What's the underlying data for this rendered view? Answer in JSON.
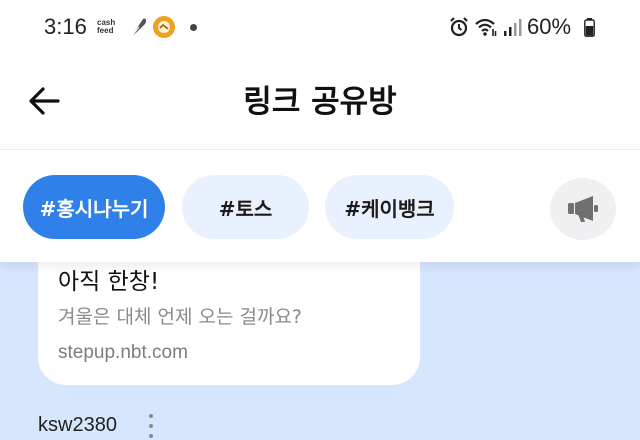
{
  "status_bar": {
    "time": "3:16",
    "cashfeed_text": "cash feed",
    "battery": "60%",
    "icons": [
      "feather-icon",
      "app-notification-icon",
      "notification-dot-icon",
      "alarm-icon",
      "wifi-icon",
      "signal-icon",
      "battery-icon"
    ]
  },
  "header": {
    "title": "링크 공유방",
    "back_icon": "arrow-left-icon"
  },
  "tags": {
    "items": [
      {
        "label": "#홍시나누기",
        "active": true
      },
      {
        "label": "#토스",
        "active": false
      },
      {
        "label": "#케이뱅크",
        "active": false
      }
    ],
    "action_icon": "megaphone-icon"
  },
  "post": {
    "card": {
      "title": "아직 한창!",
      "description": "겨울은 대체 언제 오는 걸까요?",
      "url": "stepup.nbt.com"
    },
    "author": "ksw2380",
    "more_icon": "more-vertical-icon"
  },
  "colors": {
    "accent": "#2f80e8",
    "chip_inactive": "#eaf1fe",
    "feed_background": "#d6e6fd"
  }
}
